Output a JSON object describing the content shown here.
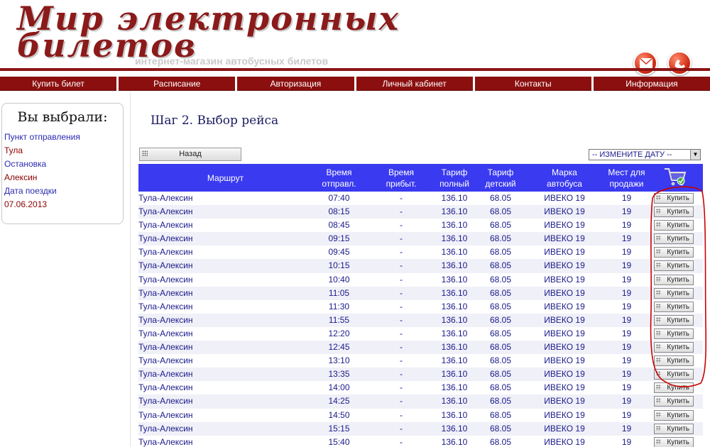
{
  "header": {
    "logo_line1": "Мир электронных",
    "logo_line2": "билетов",
    "tagline": "интернет-магазин автобусных билетов",
    "icons": [
      "mail-icon",
      "phone-icon"
    ]
  },
  "nav": [
    "Купить билет",
    "Расписание",
    "Авторизация",
    "Личный кабинет",
    "Контакты",
    "Информация"
  ],
  "sidebar": {
    "title": "Вы выбрали:",
    "departure_label": "Пункт отправления",
    "departure_value": "Тула",
    "stop_label": "Остановка",
    "stop_value": "Алексин",
    "date_label": "Дата поездки",
    "date_value": "07.06.2013"
  },
  "main": {
    "step_title": "Шаг 2. Выбор рейса",
    "back_label": "Назад",
    "date_select": "-- ИЗМЕНИТЕ ДАТУ --"
  },
  "table": {
    "headers": {
      "route": "Маршрут",
      "dep": [
        "Время",
        "отправл."
      ],
      "arr": [
        "Время",
        "прибыт."
      ],
      "full": [
        "Тариф",
        "полный"
      ],
      "child": [
        "Тариф",
        "детский"
      ],
      "brand": [
        "Марка",
        "автобуса"
      ],
      "seats": [
        "Мест для",
        "продажи"
      ]
    },
    "buy_label": "Купить",
    "rows": [
      {
        "route": "Тула-Алексин",
        "dep": "07:40",
        "arr": "-",
        "full": "136.10",
        "child": "68.05",
        "brand": "ИВЕКО 19",
        "seats": "19"
      },
      {
        "route": "Тула-Алексин",
        "dep": "08:15",
        "arr": "-",
        "full": "136.10",
        "child": "68.05",
        "brand": "ИВЕКО 19",
        "seats": "19"
      },
      {
        "route": "Тула-Алексин",
        "dep": "08:45",
        "arr": "-",
        "full": "136.10",
        "child": "68.05",
        "brand": "ИВЕКО 19",
        "seats": "19"
      },
      {
        "route": "Тула-Алексин",
        "dep": "09:15",
        "arr": "-",
        "full": "136.10",
        "child": "68.05",
        "brand": "ИВЕКО 19",
        "seats": "19"
      },
      {
        "route": "Тула-Алексин",
        "dep": "09:45",
        "arr": "-",
        "full": "136.10",
        "child": "68.05",
        "brand": "ИВЕКО 19",
        "seats": "19"
      },
      {
        "route": "Тула-Алексин",
        "dep": "10:15",
        "arr": "-",
        "full": "136.10",
        "child": "68.05",
        "brand": "ИВЕКО 19",
        "seats": "19"
      },
      {
        "route": "Тула-Алексин",
        "dep": "10:40",
        "arr": "-",
        "full": "136.10",
        "child": "68.05",
        "brand": "ИВЕКО 19",
        "seats": "19"
      },
      {
        "route": "Тула-Алексин",
        "dep": "11:05",
        "arr": "-",
        "full": "136.10",
        "child": "68.05",
        "brand": "ИВЕКО 19",
        "seats": "19"
      },
      {
        "route": "Тула-Алексин",
        "dep": "11:30",
        "arr": "-",
        "full": "136.10",
        "child": "68.05",
        "brand": "ИВЕКО 19",
        "seats": "19"
      },
      {
        "route": "Тула-Алексин",
        "dep": "11:55",
        "arr": "-",
        "full": "136.10",
        "child": "68.05",
        "brand": "ИВЕКО 19",
        "seats": "19"
      },
      {
        "route": "Тула-Алексин",
        "dep": "12:20",
        "arr": "-",
        "full": "136.10",
        "child": "68.05",
        "brand": "ИВЕКО 19",
        "seats": "19"
      },
      {
        "route": "Тула-Алексин",
        "dep": "12:45",
        "arr": "-",
        "full": "136.10",
        "child": "68.05",
        "brand": "ИВЕКО 19",
        "seats": "19"
      },
      {
        "route": "Тула-Алексин",
        "dep": "13:10",
        "arr": "-",
        "full": "136.10",
        "child": "68.05",
        "brand": "ИВЕКО 19",
        "seats": "19"
      },
      {
        "route": "Тула-Алексин",
        "dep": "13:35",
        "arr": "-",
        "full": "136.10",
        "child": "68.05",
        "brand": "ИВЕКО 19",
        "seats": "19"
      },
      {
        "route": "Тула-Алексин",
        "dep": "14:00",
        "arr": "-",
        "full": "136.10",
        "child": "68.05",
        "brand": "ИВЕКО 19",
        "seats": "19"
      },
      {
        "route": "Тула-Алексин",
        "dep": "14:25",
        "arr": "-",
        "full": "136.10",
        "child": "68.05",
        "brand": "ИВЕКО 19",
        "seats": "19"
      },
      {
        "route": "Тула-Алексин",
        "dep": "14:50",
        "arr": "-",
        "full": "136.10",
        "child": "68.05",
        "brand": "ИВЕКО 19",
        "seats": "19"
      },
      {
        "route": "Тула-Алексин",
        "dep": "15:15",
        "arr": "-",
        "full": "136.10",
        "child": "68.05",
        "brand": "ИВЕКО 19",
        "seats": "19"
      },
      {
        "route": "Тула-Алексин",
        "dep": "15:40",
        "arr": "-",
        "full": "136.10",
        "child": "68.05",
        "brand": "ИВЕКО 19",
        "seats": "19"
      }
    ]
  },
  "colors": {
    "brand": "#8b1414",
    "header_blue": "#3a3af0",
    "text_blue": "#1a1a8b",
    "highlight": "#cc0000"
  }
}
